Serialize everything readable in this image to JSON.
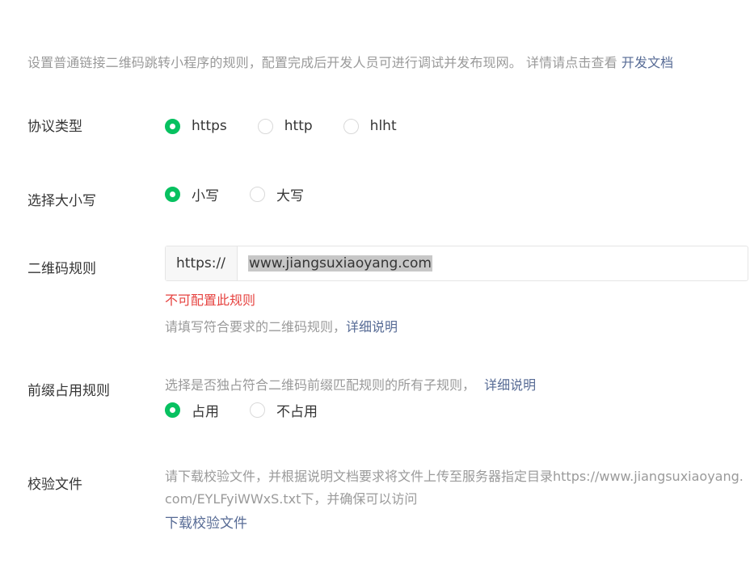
{
  "intro": {
    "text": "设置普通链接二维码跳转小程序的规则，配置完成后开发人员可进行调试并发布现网。 详情请点击查看",
    "link": "开发文档"
  },
  "protocol": {
    "label": "协议类型",
    "options": [
      "https",
      "http",
      "hlht"
    ],
    "selected": "https"
  },
  "case": {
    "label": "选择大小写",
    "options": [
      "小写",
      "大写"
    ],
    "selected": "小写"
  },
  "qr_rule": {
    "label": "二维码规则",
    "prefix": "https://",
    "value": "www.jiangsuxiaoyang.com",
    "error": "不可配置此规则",
    "tip": "请填写符合要求的二维码规则，",
    "tip_link": "详细说明"
  },
  "prefix_rule": {
    "label": "前缀占用规则",
    "tip": "选择是否独占符合二维码前缀匹配规则的所有子规则，",
    "tip_link": "详细说明",
    "options": [
      "占用",
      "不占用"
    ],
    "selected": "占用"
  },
  "verify_file": {
    "label": "校验文件",
    "desc": "请下载校验文件，并根据说明文档要求将文件上传至服务器指定目录https://www.jiangsuxiaoyang.com/EYLFyiWWxS.txt下，并确保可以访问",
    "download_link": "下载校验文件"
  },
  "colors": {
    "accent_green": "#07c160",
    "link_blue": "#576b95",
    "error_red": "#e64340",
    "muted_gray": "#9a9a9a"
  }
}
